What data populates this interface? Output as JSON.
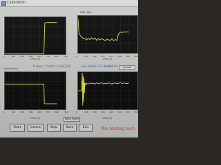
{
  "window": {
    "title": "Calibration"
  },
  "top_left": {
    "x_axis_title": "Time (s)",
    "x_ticks": [
      "0",
      "100",
      "200",
      "300",
      "400",
      "500",
      "600",
      "700"
    ],
    "y_ticks": [
      "",
      "",
      "",
      ""
    ]
  },
  "top_right": {
    "y_axis_title": "HRR (kW)",
    "x_axis_title": "Time (s)",
    "x_ticks": [
      "0",
      "100",
      "200",
      "300",
      "400",
      "500",
      "600",
      "700"
    ]
  },
  "middle": {
    "hixson_factor_label": "Hixon C factor",
    "hixson_factor_value": "0.04224",
    "iso_factor_label": "ISO 5660-1 C factor",
    "iso_factor_value": "0.04219",
    "update_button_label": "Update"
  },
  "bottom_left": {
    "y_axis_title": "Flow (l/min)",
    "x_axis_title": "Time (s)",
    "x_ticks": [
      "0",
      "100",
      "200",
      "300",
      "400",
      "500",
      "600",
      "700"
    ],
    "make_room_button_label": "Make Room"
  },
  "bottom_right": {
    "x_axis_title": "Time (s)",
    "x_ticks": [
      "0",
      "100",
      "200",
      "300",
      "400",
      "500",
      "600",
      "700"
    ]
  },
  "buttons": {
    "start": "Start",
    "cancel": "Cancel",
    "stop": "Stop",
    "save": "Save",
    "exit": "Exit"
  },
  "brand": {
    "text": "fire testing tech"
  },
  "colors": {
    "trace": "#e4e33a",
    "plot_background": "#0c0c0c",
    "brand_red": "#d23a2f",
    "factor_blue": "#3d5aa8"
  },
  "chart_data": [
    {
      "type": "line",
      "name_hint": "top-left",
      "x": [
        0,
        100,
        200,
        300,
        400,
        450,
        460,
        500,
        550,
        600
      ],
      "y": [
        0.02,
        0.02,
        0.02,
        0.02,
        0.02,
        0.02,
        0.85,
        0.86,
        0.86,
        0.86
      ],
      "xlabel": "Time (s)",
      "xlim": [
        0,
        700
      ],
      "ylim": [
        0,
        1
      ]
    },
    {
      "type": "line",
      "name_hint": "top-right",
      "x": [
        0,
        10,
        30,
        50,
        60,
        80,
        100,
        120,
        140,
        160,
        180,
        200,
        220,
        240,
        260,
        280,
        300,
        320,
        340,
        360,
        380,
        400,
        420,
        440,
        460,
        470,
        480,
        490,
        500,
        520,
        540,
        560,
        580,
        600
      ],
      "y": [
        0.92,
        0.55,
        0.45,
        0.42,
        0.38,
        0.4,
        0.35,
        0.39,
        0.36,
        0.41,
        0.37,
        0.4,
        0.34,
        0.39,
        0.35,
        0.38,
        0.36,
        0.33,
        0.37,
        0.35,
        0.34,
        0.38,
        0.33,
        0.36,
        0.34,
        0.45,
        0.52,
        0.55,
        0.56,
        0.55,
        0.57,
        0.56,
        0.57,
        0.56
      ],
      "xlabel": "Time (s)",
      "xlim": [
        0,
        700
      ],
      "ylim": [
        0,
        1
      ]
    },
    {
      "type": "line",
      "name_hint": "bottom-left",
      "x": [
        0,
        100,
        200,
        300,
        400,
        450,
        455,
        480,
        500,
        600
      ],
      "y": [
        0.68,
        0.68,
        0.68,
        0.68,
        0.68,
        0.68,
        0.15,
        0.15,
        0.15,
        0.15
      ],
      "xlabel": "Time (s)",
      "xlim": [
        0,
        700
      ],
      "ylim": [
        0,
        1
      ]
    },
    {
      "type": "line",
      "name_hint": "bottom-right",
      "x": [
        0,
        40,
        50,
        55,
        60,
        65,
        70,
        75,
        80,
        90,
        100,
        120,
        140,
        160,
        180,
        200,
        220,
        240,
        260,
        280,
        300,
        320,
        340,
        360,
        380,
        400,
        420,
        440,
        460,
        480,
        500,
        520,
        540,
        560,
        580,
        600
      ],
      "y": [
        0.5,
        0.5,
        0.98,
        0.1,
        0.9,
        0.2,
        0.85,
        0.45,
        0.72,
        0.65,
        0.7,
        0.68,
        0.71,
        0.69,
        0.7,
        0.68,
        0.71,
        0.69,
        0.7,
        0.72,
        0.68,
        0.7,
        0.69,
        0.71,
        0.7,
        0.68,
        0.7,
        0.71,
        0.69,
        0.7,
        0.72,
        0.69,
        0.71,
        0.7,
        0.69,
        0.71
      ],
      "xlabel": "Time (s)",
      "xlim": [
        0,
        700
      ],
      "ylim": [
        0,
        1
      ]
    }
  ]
}
